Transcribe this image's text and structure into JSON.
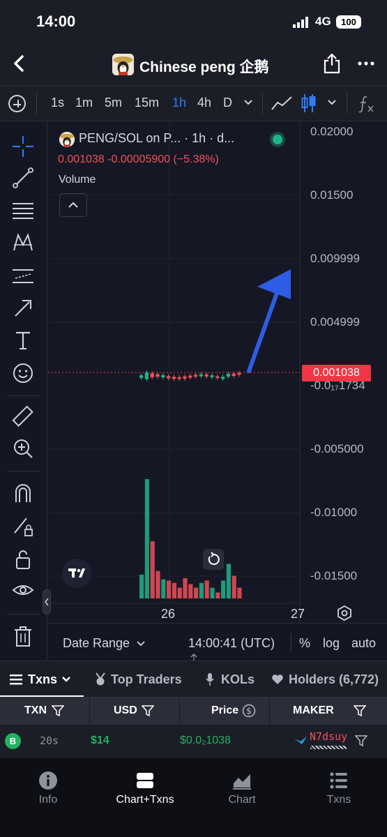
{
  "status_bar": {
    "time": "14:00",
    "network": "4G",
    "battery": "100"
  },
  "nav": {
    "title": "Chinese peng 企鹅",
    "icons": [
      "back-icon",
      "share-icon",
      "more-icon"
    ]
  },
  "intervals": {
    "items": [
      "1s",
      "1m",
      "5m",
      "15m",
      "1h",
      "4h",
      "D"
    ],
    "active": "1h"
  },
  "legend": {
    "title": "PENG/SOL on P... · 1h · d...",
    "price_line": "0.001038  -0.00005900 (−5.38%)",
    "volume_label": "Volume"
  },
  "y_axis": [
    "0.02000",
    "0.01500",
    "0.009999",
    "0.004999",
    "-0.0₁₇1734",
    "-0.005000",
    "-0.01000",
    "-0.01500"
  ],
  "current_price": "0.001038",
  "x_axis": [
    "26",
    "27"
  ],
  "chart_bottom": {
    "date_range": "Date Range",
    "clock": "14:00:41 (UTC)",
    "percent": "%",
    "log": "log",
    "auto": "auto"
  },
  "chart_data": {
    "type": "candlestick",
    "y_axis_ticks": [
      0.02,
      0.015,
      0.009999,
      0.004999,
      -0.005,
      -0.01,
      -0.015
    ],
    "last_price": 0.001038,
    "change": -5.9e-05,
    "change_pct": -5.38,
    "ylim": [
      -0.0175,
      0.021
    ],
    "volume_bars": [
      {
        "value": 0.2,
        "color": "#20b388"
      },
      {
        "value": 1.0,
        "color": "#20b388"
      },
      {
        "value": 0.48,
        "color": "#f04f5a"
      },
      {
        "value": 0.23,
        "color": "#f04f5a"
      },
      {
        "value": 0.16,
        "color": "#20b388"
      },
      {
        "value": 0.15,
        "color": "#f04f5a"
      },
      {
        "value": 0.13,
        "color": "#f04f5a"
      },
      {
        "value": 0.09,
        "color": "#f04f5a"
      },
      {
        "value": 0.17,
        "color": "#f04f5a"
      },
      {
        "value": 0.12,
        "color": "#f04f5a"
      },
      {
        "value": 0.09,
        "color": "#f04f5a"
      },
      {
        "value": 0.13,
        "color": "#20b388"
      },
      {
        "value": 0.15,
        "color": "#f04f5a"
      },
      {
        "value": 0.09,
        "color": "#20b388"
      },
      {
        "value": 0.05,
        "color": "#f04f5a"
      },
      {
        "value": 0.15,
        "color": "#20b388"
      },
      {
        "value": 0.29,
        "color": "#20b388"
      },
      {
        "value": 0.19,
        "color": "#f04f5a"
      },
      {
        "value": 0.09,
        "color": "#f04f5a"
      }
    ]
  },
  "txn_tabs": [
    "Txns",
    "Top Traders",
    "KOLs",
    "Holders (6,772)"
  ],
  "table": {
    "headers": [
      "TXN",
      "USD",
      "Price",
      "MAKER"
    ],
    "rows": [
      {
        "type": "B",
        "age": "20s",
        "usd": "$14",
        "price": "$0.0₂1038",
        "maker": "N7dsuy"
      }
    ]
  },
  "home_tabs": [
    {
      "label": "Info",
      "icon": "info-icon"
    },
    {
      "label": "Chart+Txns",
      "icon": "chart-txns-icon"
    },
    {
      "label": "Chart",
      "icon": "area-chart-icon"
    },
    {
      "label": "Txns",
      "icon": "list-icon"
    }
  ],
  "colors": {
    "up": "#20b388",
    "down": "#f04f5a",
    "accent": "#2e7cf6",
    "background": "#141722"
  }
}
